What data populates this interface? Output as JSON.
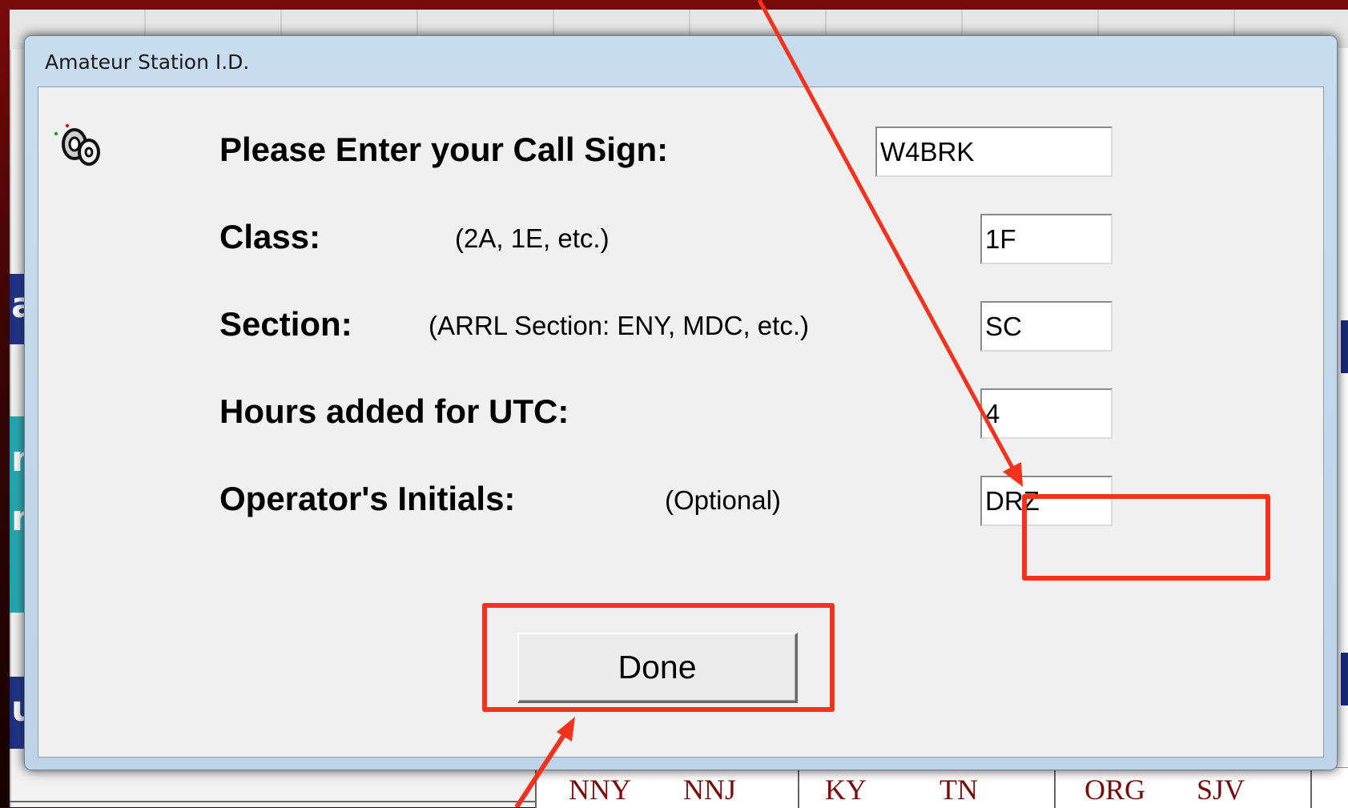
{
  "dialog": {
    "title": "Amateur Station I.D.",
    "done_label": "Done"
  },
  "fields": [
    {
      "label": "Please Enter your Call Sign:",
      "hint": "",
      "value": "W4BRK"
    },
    {
      "label": "Class:",
      "hint": "(2A, 1E, etc.)",
      "value": "1F"
    },
    {
      "label": "Section:",
      "hint": "(ARRL Section: ENY, MDC, etc.)",
      "value": "SC"
    },
    {
      "label": "Hours added for UTC:",
      "hint": "",
      "value": "4"
    },
    {
      "label": "Operator's Initials:",
      "hint": "(Optional)",
      "value": "DRZ"
    }
  ],
  "background": {
    "footer_items": [
      "NNY",
      "NNJ",
      "KY",
      "TN",
      "ORG",
      "SJV"
    ],
    "left_strip_chars": [
      "a",
      "n",
      "n",
      "u"
    ]
  },
  "annotations": {
    "highlight_color": "#f5321e",
    "highlighted": [
      "operator-initials-field",
      "done-button"
    ]
  },
  "icons": {
    "app_icon": "cassette-reel-icon"
  }
}
